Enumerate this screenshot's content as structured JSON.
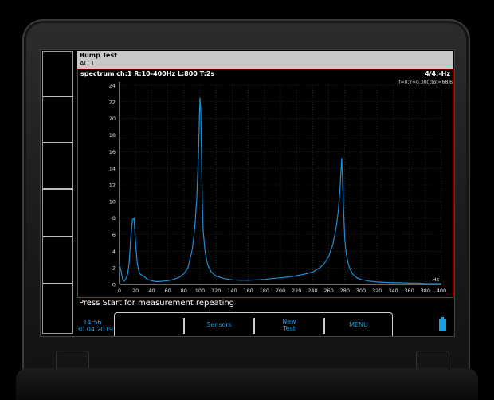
{
  "header": {
    "title": "Bump Test",
    "subtitle": "AC 1"
  },
  "plot": {
    "info_left": "spectrum ch:1 R:10-400Hz L:800 T:2s",
    "info_right": "4/4;-Hz",
    "cursor_readout": "f=0;Y=0.000;tot=68.6"
  },
  "chart_data": {
    "type": "line",
    "xlabel": "Hz",
    "ylabel": "",
    "xlim": [
      0,
      400
    ],
    "ylim": [
      0,
      24
    ],
    "x_ticks": [
      0,
      20,
      40,
      60,
      80,
      100,
      120,
      140,
      160,
      180,
      200,
      220,
      240,
      260,
      280,
      300,
      320,
      340,
      360,
      380,
      400
    ],
    "y_ticks": [
      0,
      2,
      4,
      6,
      8,
      10,
      12,
      14,
      16,
      18,
      20,
      22,
      24
    ],
    "grid": true,
    "line_color": "#1e8fd6",
    "series": [
      {
        "x": [
          0,
          2,
          4,
          6,
          8,
          10,
          12,
          14,
          16,
          18,
          20,
          22,
          24,
          26,
          28,
          30,
          35,
          40,
          45,
          50,
          55,
          60,
          65,
          70,
          75,
          80,
          85,
          90,
          92,
          94,
          96,
          98,
          100,
          101,
          102,
          103,
          104,
          106,
          108,
          110,
          114,
          120,
          130,
          140,
          150,
          160,
          170,
          180,
          190,
          200,
          210,
          220,
          230,
          240,
          250,
          255,
          260,
          265,
          268,
          270,
          272,
          274,
          276,
          277,
          278,
          279,
          280,
          282,
          284,
          286,
          290,
          295,
          300,
          310,
          320,
          330,
          340,
          350,
          360,
          370,
          380,
          390,
          400
        ],
        "y": [
          2.4,
          1.6,
          0.6,
          0.4,
          0.7,
          1.2,
          2.6,
          5.6,
          7.8,
          8.0,
          5.0,
          2.6,
          1.6,
          1.2,
          1.1,
          1.0,
          0.6,
          0.45,
          0.35,
          0.35,
          0.4,
          0.45,
          0.55,
          0.7,
          0.9,
          1.3,
          2.0,
          4.0,
          5.4,
          7.4,
          10.5,
          15.5,
          22.5,
          21.0,
          15.0,
          9.5,
          6.5,
          4.2,
          3.0,
          2.3,
          1.5,
          1.0,
          0.7,
          0.55,
          0.5,
          0.5,
          0.55,
          0.6,
          0.7,
          0.8,
          0.9,
          1.05,
          1.25,
          1.5,
          2.1,
          2.6,
          3.4,
          4.8,
          6.2,
          7.4,
          9.0,
          11.5,
          15.2,
          13.0,
          10.0,
          7.5,
          5.3,
          3.6,
          2.6,
          1.9,
          1.2,
          0.8,
          0.6,
          0.4,
          0.3,
          0.25,
          0.2,
          0.2,
          0.15,
          0.15,
          0.1,
          0.1,
          0.1
        ]
      }
    ]
  },
  "status": "Press Start for measurement repeating",
  "footer": {
    "time": "14:56",
    "date": "30.04.2019",
    "buttons": [
      {
        "label": ""
      },
      {
        "label": "Sensors"
      },
      {
        "label_line1": "New",
        "label_line2": "Test"
      },
      {
        "label": "MENU"
      }
    ],
    "accent_color": "#1aa0e0"
  }
}
